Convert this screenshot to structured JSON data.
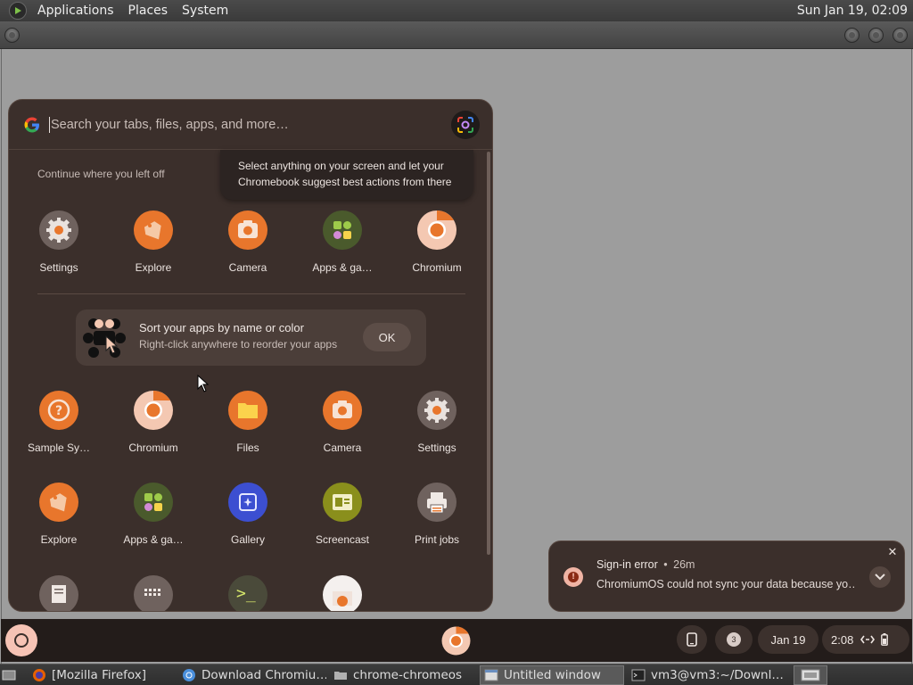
{
  "top_panel": {
    "menus": [
      "Applications",
      "Places",
      "System"
    ],
    "clock": "Sun Jan 19, 02:09"
  },
  "launcher": {
    "search_placeholder": "Search your tabs, files, apps, and more…",
    "continue_title": "Continue where you left off",
    "tooltip": [
      "Select anything on your screen and let your",
      "Chromebook suggest best actions from there"
    ],
    "recent_apps": [
      {
        "label": "Settings",
        "icon": "settings-icon"
      },
      {
        "label": "Explore",
        "icon": "explore-icon"
      },
      {
        "label": "Camera",
        "icon": "camera-icon"
      },
      {
        "label": "Apps & ga…",
        "icon": "apps-games-icon"
      },
      {
        "label": "Chromium",
        "icon": "chromium-icon"
      }
    ],
    "sort_card": {
      "title": "Sort your apps by name or color",
      "subtitle": "Right-click anywhere to reorder your apps",
      "ok": "OK"
    },
    "grid_row1": [
      {
        "label": "Sample Sy…",
        "icon": "help-icon"
      },
      {
        "label": "Chromium",
        "icon": "chromium-icon"
      },
      {
        "label": "Files",
        "icon": "files-icon"
      },
      {
        "label": "Camera",
        "icon": "camera-icon"
      },
      {
        "label": "Settings",
        "icon": "settings-icon"
      }
    ],
    "grid_row2": [
      {
        "label": "Explore",
        "icon": "explore-icon"
      },
      {
        "label": "Apps & ga…",
        "icon": "apps-games-icon"
      },
      {
        "label": "Gallery",
        "icon": "gallery-icon"
      },
      {
        "label": "Screencast",
        "icon": "screencast-icon"
      },
      {
        "label": "Print jobs",
        "icon": "print-icon"
      }
    ]
  },
  "notification": {
    "title": "Sign-in error",
    "time": "26m",
    "separator": "•",
    "body": "ChromiumOS could not sync your data because yo…",
    "close": "✕"
  },
  "shelf": {
    "badge": "3",
    "date": "Jan 19",
    "time": "2:08"
  },
  "taskbar": {
    "tasks": [
      "[Mozilla Firefox]",
      "Download Chromiu…",
      "chrome-chromeos",
      "Untitled window",
      "vm3@vm3:~/Downl…"
    ]
  },
  "colors": {
    "launcher_bg": "#3b2f2b",
    "accent_orange": "#e8762c",
    "shelf_bg": "#231c1a"
  }
}
